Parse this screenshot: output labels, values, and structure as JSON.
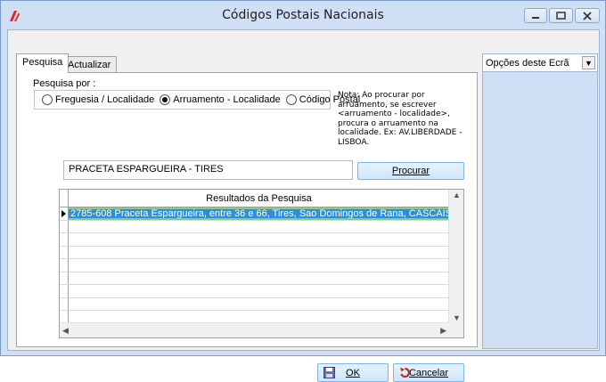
{
  "window": {
    "title": "Códigos Postais Nacionais",
    "minimize_glyph": "—",
    "maximize_glyph": "▢",
    "close_glyph": "✕"
  },
  "tabs": [
    {
      "label": "Pesquisa",
      "active": true
    },
    {
      "label": "Actualizar",
      "active": false
    }
  ],
  "search": {
    "by_label": "Pesquisa por :",
    "options": [
      {
        "label": "Freguesia / Localidade",
        "selected": false
      },
      {
        "label": "Arruamento - Localidade",
        "selected": true
      },
      {
        "label": "Código Postal",
        "selected": false
      }
    ],
    "note": "Nota: Ao procurar por arruamento, se escrever <arruamento - localidade>, procura o arruamento na localidade. Ex: AV.LIBERDADE - LISBOA.",
    "input_value": "PRACETA ESPARGUEIRA - TIRES",
    "search_button": "Procurar"
  },
  "results": {
    "header": "Resultados da Pesquisa",
    "rows": [
      "2785-608 Praceta Espargueira, entre 36 e 66, Tires, Sao Domingos de Rana, CASCAIS"
    ]
  },
  "buttons": {
    "ok": "OK",
    "cancel": "Cancelar"
  },
  "options_panel": {
    "label": "Opções deste Ecrã"
  },
  "colors": {
    "selection": "#2e8ddf",
    "selection_border": "#7fd07a",
    "title_bg": "#cfe0f4",
    "app_icon": "#e8202a"
  }
}
